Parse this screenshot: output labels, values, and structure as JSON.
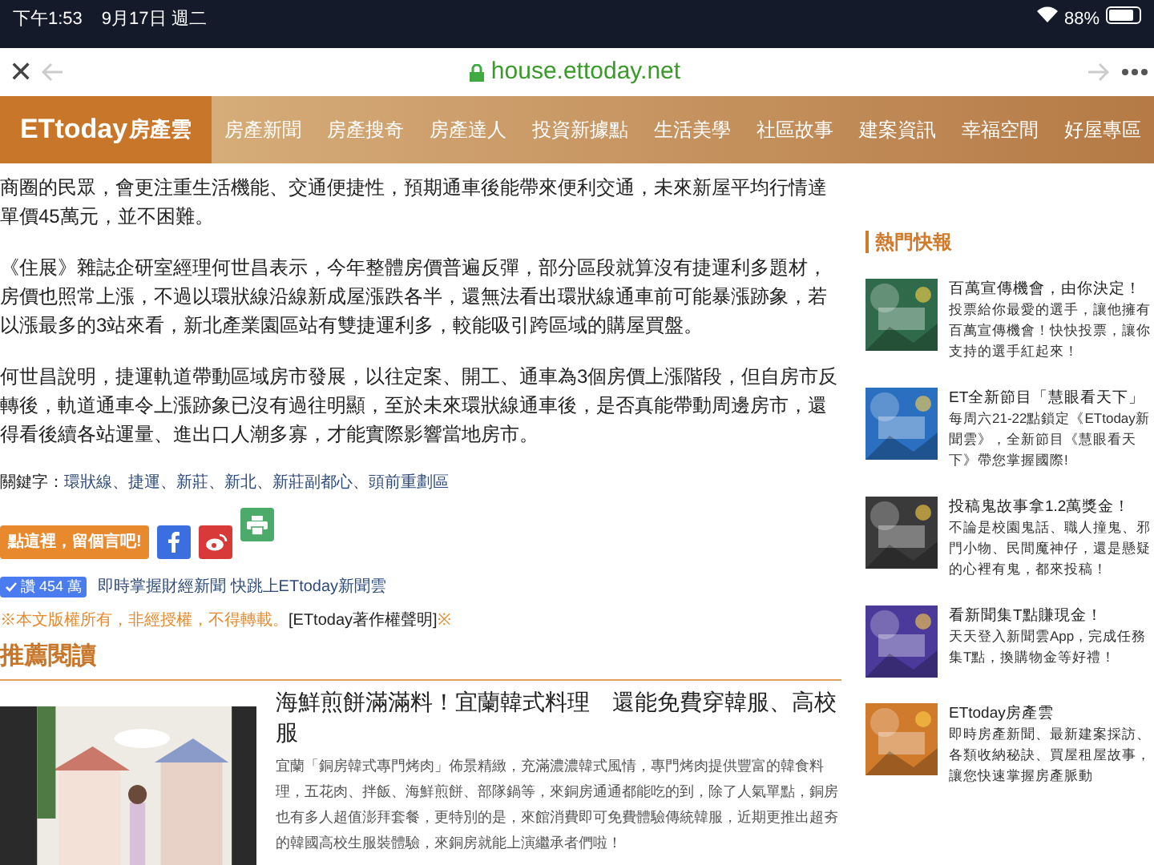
{
  "status_bar": {
    "time": "下午1:53",
    "date": "9月17日 週二",
    "battery": "88%"
  },
  "browser": {
    "close": "✕",
    "url": "house.ettoday.net"
  },
  "nav": {
    "logo": "ETtoday",
    "logo_suffix": "房產雲",
    "items": [
      "房產新聞",
      "房產搜奇",
      "房產達人",
      "投資新據點",
      "生活美學",
      "社區故事",
      "建案資訊",
      "幸福空間",
      "好屋專區"
    ]
  },
  "article": {
    "paragraphs": [
      "商圈的民眾，會更注重生活機能、交通便捷性，預期通車後能帶來便利交通，未來新屋平均行情達單價45萬元，並不困難。",
      "《住展》雜誌企研室經理何世昌表示，今年整體房價普遍反彈，部分區段就算沒有捷運利多題材，房價也照常上漲，不過以環狀線沿線新成屋漲跌各半，還無法看出環狀線通車前可能暴漲跡象，若以漲最多的3站來看，新北產業園區站有雙捷運利多，較能吸引跨區域的購屋買盤。",
      "何世昌說明，捷運軌道帶動區域房市發展，以往定案、開工、通車為3個房價上漲階段，但自房市反轉後，軌道通車令上漲跡象已沒有過往明顯，至於未來環狀線通車後，是否真能帶動周邊房市，還得看後續各站運量、進出口人潮多寡，才能實際影響當地房市。"
    ],
    "keywords_label": "關鍵字：",
    "keyword_separator": "、",
    "keywords": [
      "環狀線",
      "捷運",
      "新莊",
      "新北",
      "新莊副都心",
      "頭前重劃區"
    ],
    "comment_button": "點這裡，留個言吧!",
    "like_badge": "讚 454 萬",
    "promo_link": "即時掌握財經新聞 快跳上ETtoday新聞雲",
    "copyright": {
      "notice": "※本文版權所有，非經授權，不得轉載。",
      "link": "[ETtoday著作權聲明]",
      "mark": "※"
    },
    "recommended": {
      "heading": "推薦閱讀",
      "title": "海鮮煎餅滿滿料！宜蘭韓式料理　還能免費穿韓服、高校服",
      "summary": "宜蘭「銅房韓式專門烤肉」佈景精緻，充滿濃濃韓式風情，專門烤肉提供豐富的韓食料理，五花肉、拌飯、海鮮煎餅、部隊鍋等，來銅房通通都能吃的到，除了人氣單點，銅房也有多人超值澎拜套餐，更特別的是，來館消費即可免費體驗傳統韓服，近期更推出超夯的韓國高校生服裝體驗，來銅房就能上演繼承者們啦！"
    }
  },
  "sidebar": {
    "heading": "熱門快報",
    "items": [
      {
        "title": "百萬宣傳機會，由你決定！",
        "text": "投票給你最愛的選手，讓他擁有百萬宣傳機會！快快投票，讓你支持的選手紅起來！",
        "color": "#2f6b4a"
      },
      {
        "title": "ET全新節目「慧眼看天下」",
        "text": "每周六21-22點鎖定《ETtoday新聞雲》，全新節目《慧眼看天下》帶您掌握國際!",
        "color": "#2a6fc0"
      },
      {
        "title": "投稿鬼故事拿1.2萬獎金！",
        "text": "不論是校園鬼話、職人撞鬼、邪門小物、民間魔神仔，還是懸疑的心裡有鬼，都來投稿！",
        "color": "#3a3a3a"
      },
      {
        "title": "看新聞集T點賺現金！",
        "text": "天天登入新聞雲App，完成任務集T點，換購物金等好禮！",
        "color": "#4b3a9a"
      },
      {
        "title": "ETtoday房產雲",
        "text": "即時房產新聞、最新建案採訪、各類收納秘訣、買屋租屋故事，讓您快速掌握房產脈動",
        "color": "#d07a2c"
      }
    ]
  }
}
